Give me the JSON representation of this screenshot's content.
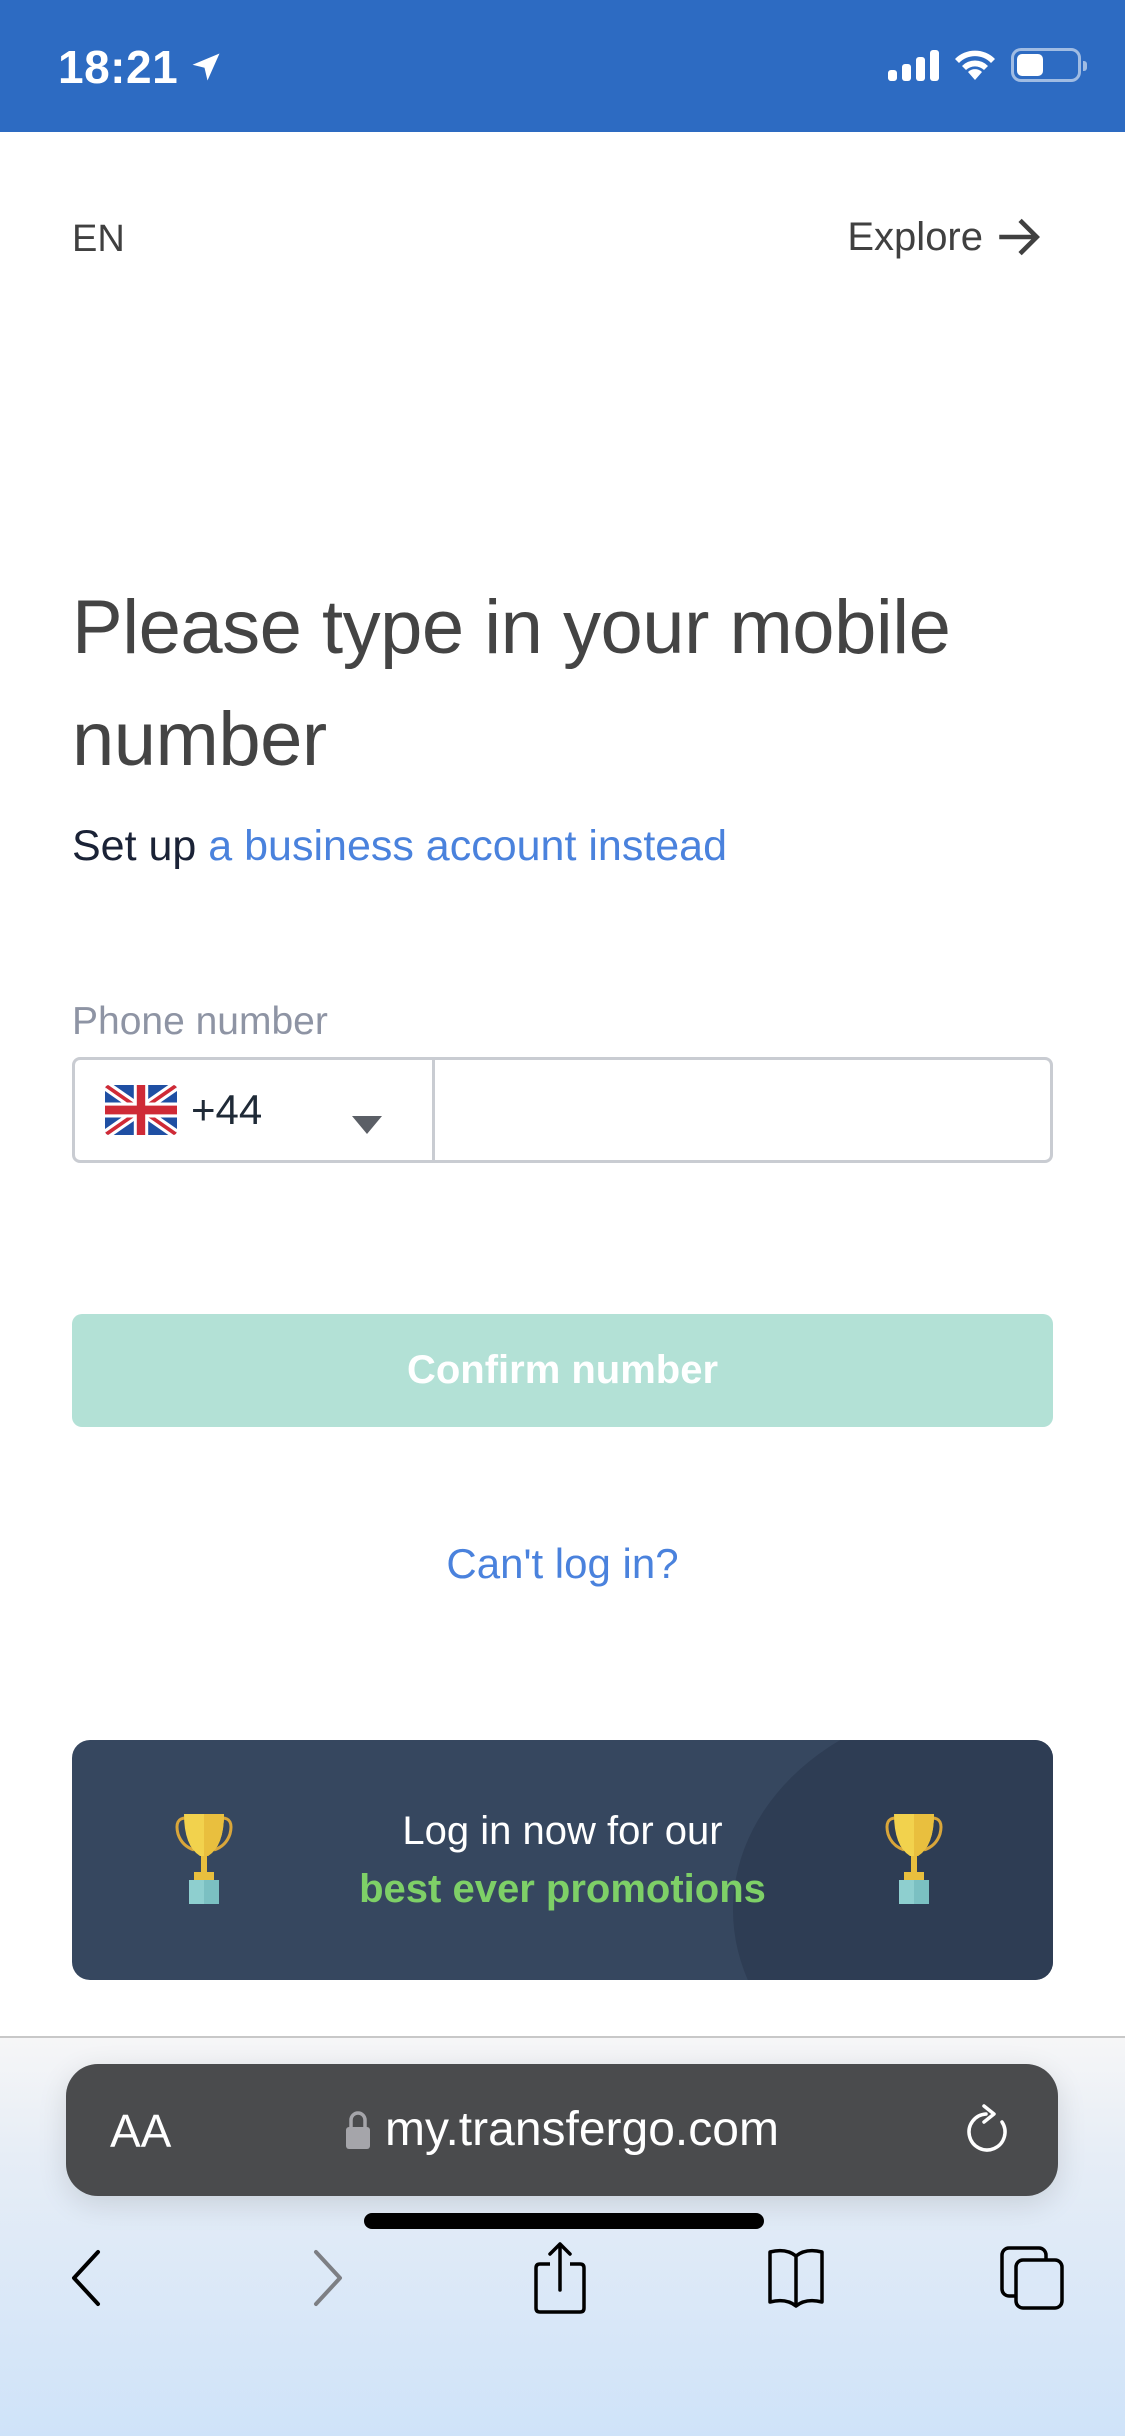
{
  "status_bar": {
    "time": "18:21",
    "location_icon": "location-arrow-icon",
    "signal_icon": "cellular-signal-icon",
    "wifi_icon": "wifi-icon",
    "battery_icon": "battery-icon",
    "battery_level_percent": 45,
    "background_color": "#2d6bc2"
  },
  "top_nav": {
    "language": "EN",
    "explore_label": "Explore",
    "explore_icon": "arrow-right-icon"
  },
  "main": {
    "title": "Please type in your mobile number",
    "subtitle_prefix": "Set up",
    "subtitle_link": "a business account instead",
    "phone_label": "Phone number",
    "country_flag_icon": "uk-flag-icon",
    "country_code": "+44",
    "phone_value": "",
    "phone_placeholder": "",
    "confirm_label": "Confirm number",
    "cant_login_label": "Can't log in?"
  },
  "promo": {
    "line1": "Log in now for our",
    "line2": "best ever promotions",
    "icon": "trophy-icon"
  },
  "browser": {
    "text_size_label": "AA",
    "url": "my.transfergo.com",
    "lock_icon": "lock-icon",
    "reload_icon": "reload-icon",
    "toolbar": [
      "back-icon",
      "forward-icon",
      "share-icon",
      "bookmarks-icon",
      "tabs-icon"
    ]
  },
  "colors": {
    "link": "#4a82dd",
    "confirm_disabled": "#b3e1d6",
    "promo_bg": "#36475f",
    "promo_highlight": "#7ed067"
  }
}
